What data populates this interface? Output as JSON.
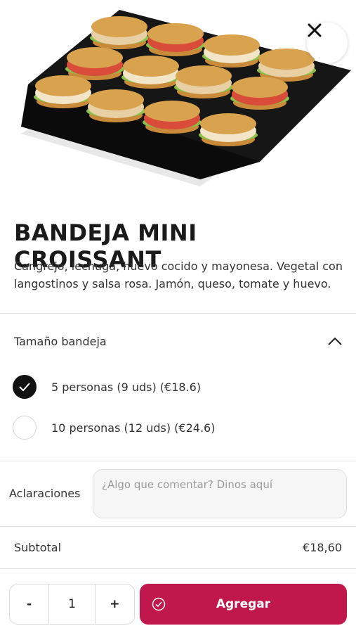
{
  "product": {
    "image_alt": "product-photo",
    "title": "BANDEJA MINI CROISSANT",
    "description": "Cangrejo, lechuga, huevo cocido y mayonesa. Vegetal con langostinos y salsa rosa. Jamón, queso, tomate y huevo."
  },
  "size_section": {
    "label": "Tamaño bandeja",
    "icon": "chevron-up-icon",
    "options": [
      {
        "label": "5 personas (9 uds) (€18.6)",
        "selected": true
      },
      {
        "label": "10 personas (12 uds) (€24.6)",
        "selected": false
      }
    ]
  },
  "notes": {
    "label": "Aclaraciones",
    "placeholder": "¿Algo que comentar? Dinos aquí",
    "value": ""
  },
  "subtotal": {
    "label": "Subtotal",
    "value": "€18,60"
  },
  "quantity": {
    "decrement": "-",
    "value": "1",
    "increment": "+"
  },
  "add_button": {
    "label": "Agregar",
    "icon": "check-circle-icon"
  },
  "close_button": {
    "icon": "close-icon"
  },
  "colors": {
    "accent": "#c0174d",
    "selected_radio": "#111111"
  }
}
